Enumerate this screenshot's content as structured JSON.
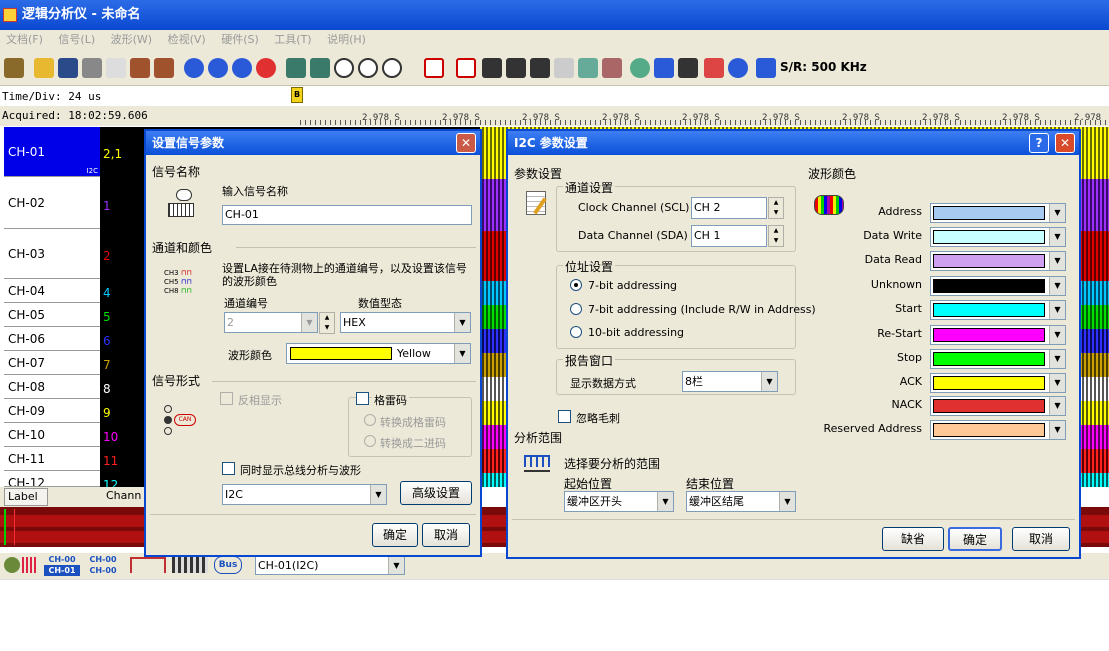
{
  "app": {
    "title": "逻辑分析仪 - 未命名"
  },
  "menu": [
    "文档(F)",
    "信号(L)",
    "波形(W)",
    "检视(V)",
    "硬件(S)",
    "工具(T)",
    "说明(H)"
  ],
  "toolbar": {
    "sample_rate": "S/R: 500 KHz"
  },
  "status": {
    "time_div": "Time/Div: 24 us",
    "acquired": "Acquired: 18:02:59.606",
    "marker": "B"
  },
  "ruler": {
    "ticks": [
      "2.978 S",
      "2.978 S",
      "2.978 S",
      "2.978 S",
      "2.978 S",
      "2.978 S",
      "2.978 S",
      "2.978 S",
      "2.978 S",
      "2.978 S",
      "2.978 S"
    ]
  },
  "channels": [
    {
      "name": "CH-01",
      "num": "2,1",
      "color": "#ffff00",
      "tag": "I2C"
    },
    {
      "name": "CH-02",
      "num": "1",
      "color": "#9b30ff"
    },
    {
      "name": "CH-03",
      "num": "2",
      "color": "#e00000"
    },
    {
      "name": "CH-04",
      "num": "4",
      "color": "#00c8ff"
    },
    {
      "name": "CH-05",
      "num": "5",
      "color": "#00e000"
    },
    {
      "name": "CH-06",
      "num": "6",
      "color": "#3030ff"
    },
    {
      "name": "CH-07",
      "num": "7",
      "color": "#c8a000"
    },
    {
      "name": "CH-08",
      "num": "8",
      "color": "#ffffff"
    },
    {
      "name": "CH-09",
      "num": "9",
      "color": "#ffff00"
    },
    {
      "name": "CH-10",
      "num": "10",
      "color": "#ff00ff"
    },
    {
      "name": "CH-11",
      "num": "11",
      "color": "#ff2020"
    },
    {
      "name": "CH-12",
      "num": "12",
      "color": "#00ffff"
    }
  ],
  "labels": {
    "label_header": "Label",
    "channel_header": "Chann"
  },
  "bottom": {
    "ch_top_a": "CH-00",
    "ch_top_b": "CH-01",
    "ch_bot_a": "CH-00",
    "ch_bot_b": "CH-00",
    "bus": "Bus",
    "bus_select": "CH-01(I2C)"
  },
  "signal_dialog": {
    "title": "设置信号参数",
    "name_section": "信号名称",
    "name_prompt": "输入信号名称",
    "name_value": "CH-01",
    "channel_section": "通道和颜色",
    "channel_desc": "设置LA接在待测物上的通道编号，以及设置该信号的波形颜色",
    "channel_no_label": "通道编号",
    "channel_no_value": "2",
    "value_format_label": "数值型态",
    "value_format_value": "HEX",
    "wave_color_label": "波形颜色",
    "wave_color_value": "Yellow",
    "wave_color": "#ffff00",
    "form_section": "信号形式",
    "invert": "反相显示",
    "gray_code": "格雷码",
    "to_gray": "转换成格雷码",
    "to_binary": "转换成二进码",
    "show_bus": "同时显示总线分析与波形",
    "protocol": "I2C",
    "advanced": "高级设置",
    "ok": "确定",
    "cancel": "取消",
    "icon_labels": [
      "CH3",
      "CH5",
      "CH8"
    ]
  },
  "i2c_dialog": {
    "title": "I2C 参数设置",
    "params_section": "参数设置",
    "channel_group": "通道设置",
    "scl_label": "Clock Channel (SCL)",
    "scl_value": "CH 2",
    "sda_label": "Data Channel (SDA)",
    "sda_value": "CH 1",
    "addr_group": "位址设置",
    "addr_opts": [
      "7-bit addressing",
      "7-bit addressing (Include R/W in Address)",
      "10-bit addressing"
    ],
    "report_group": "报告窗口",
    "report_label": "显示数据方式",
    "report_value": "8栏",
    "ignore_glitch": "忽略毛刺",
    "range_section": "分析范围",
    "range_desc": "选择要分析的范围",
    "start_label": "起始位置",
    "start_value": "缓冲区开头",
    "end_label": "结束位置",
    "end_value": "缓冲区结尾",
    "color_section": "波形颜色",
    "colors": [
      {
        "name": "Address",
        "color": "#a6caf0"
      },
      {
        "name": "Data Write",
        "color": "#c8ffff"
      },
      {
        "name": "Data Read",
        "color": "#cfa0f0"
      },
      {
        "name": "Unknown",
        "color": "#000000"
      },
      {
        "name": "Start",
        "color": "#00ffff"
      },
      {
        "name": "Re-Start",
        "color": "#ff00ff"
      },
      {
        "name": "Stop",
        "color": "#00ff00"
      },
      {
        "name": "ACK",
        "color": "#ffff00"
      },
      {
        "name": "NACK",
        "color": "#e03030"
      },
      {
        "name": "Reserved Address",
        "color": "#ffc896"
      }
    ],
    "default": "缺省",
    "ok": "确定",
    "cancel": "取消"
  }
}
